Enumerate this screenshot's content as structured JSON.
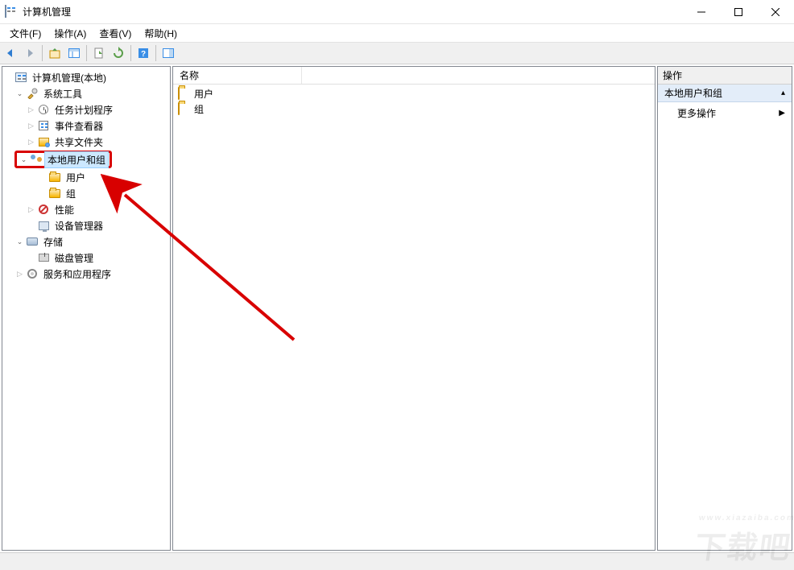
{
  "window": {
    "title": "计算机管理"
  },
  "menu": {
    "file": "文件(F)",
    "action": "操作(A)",
    "view": "查看(V)",
    "help": "帮助(H)"
  },
  "tree": {
    "root": "计算机管理(本地)",
    "system_tools": "系统工具",
    "task_scheduler": "任务计划程序",
    "event_viewer": "事件查看器",
    "shared_folders": "共享文件夹",
    "local_users_groups": "本地用户和组",
    "users": "用户",
    "groups": "组",
    "performance": "性能",
    "device_manager": "设备管理器",
    "storage": "存储",
    "disk_management": "磁盘管理",
    "services_apps": "服务和应用程序"
  },
  "list": {
    "header_name": "名称",
    "items": [
      {
        "label": "用户"
      },
      {
        "label": "组"
      }
    ]
  },
  "actions": {
    "title": "操作",
    "section": "本地用户和组",
    "more": "更多操作"
  },
  "watermark": {
    "main": "下载吧",
    "sub": "www.xiazaiba.com"
  }
}
